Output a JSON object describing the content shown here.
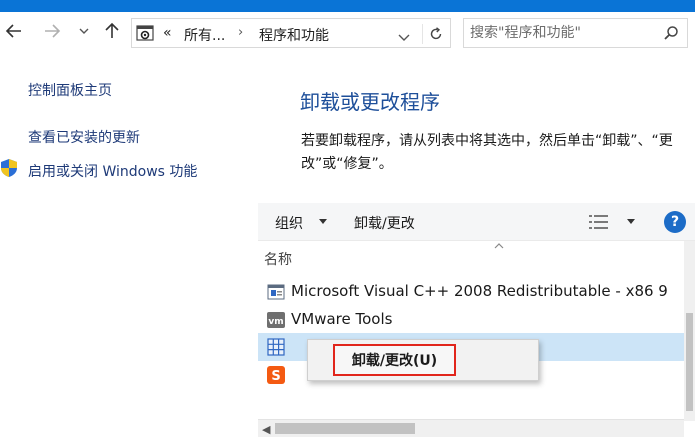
{
  "nav": {
    "address_crumbs": [
      "«",
      "所有...",
      "程序和功能"
    ],
    "search_placeholder": "搜索\"程序和功能\""
  },
  "sidebar": {
    "items": [
      {
        "label": "控制面板主页"
      },
      {
        "label": "查看已安装的更新"
      },
      {
        "label": "启用或关闭 Windows 功能"
      }
    ]
  },
  "main": {
    "heading": "卸载或更改程序",
    "description": "若要卸载程序，请从列表中将其选中，然后单击“卸载”、“更改”或“修复”。"
  },
  "toolbar": {
    "organize_label": "组织",
    "uninstall_label": "卸载/更改",
    "help_label": "?"
  },
  "list": {
    "column_header": "名称",
    "rows": [
      {
        "name": "Microsoft Visual C++ 2008 Redistributable - x86 9",
        "icon": "installer-icon"
      },
      {
        "name": "VMware Tools",
        "icon": "vmware-icon"
      },
      {
        "name": "",
        "icon": "app-grid-icon",
        "selected": true
      },
      {
        "name": "",
        "icon": "sogou-icon"
      }
    ]
  },
  "context_menu": {
    "item_label": "卸载/更改(U)"
  },
  "colors": {
    "accent": "#0a74d6",
    "link": "#1e3a78",
    "heading": "#1e4f9a",
    "selection": "#cce4f7",
    "highlight_border": "#e1251b"
  }
}
